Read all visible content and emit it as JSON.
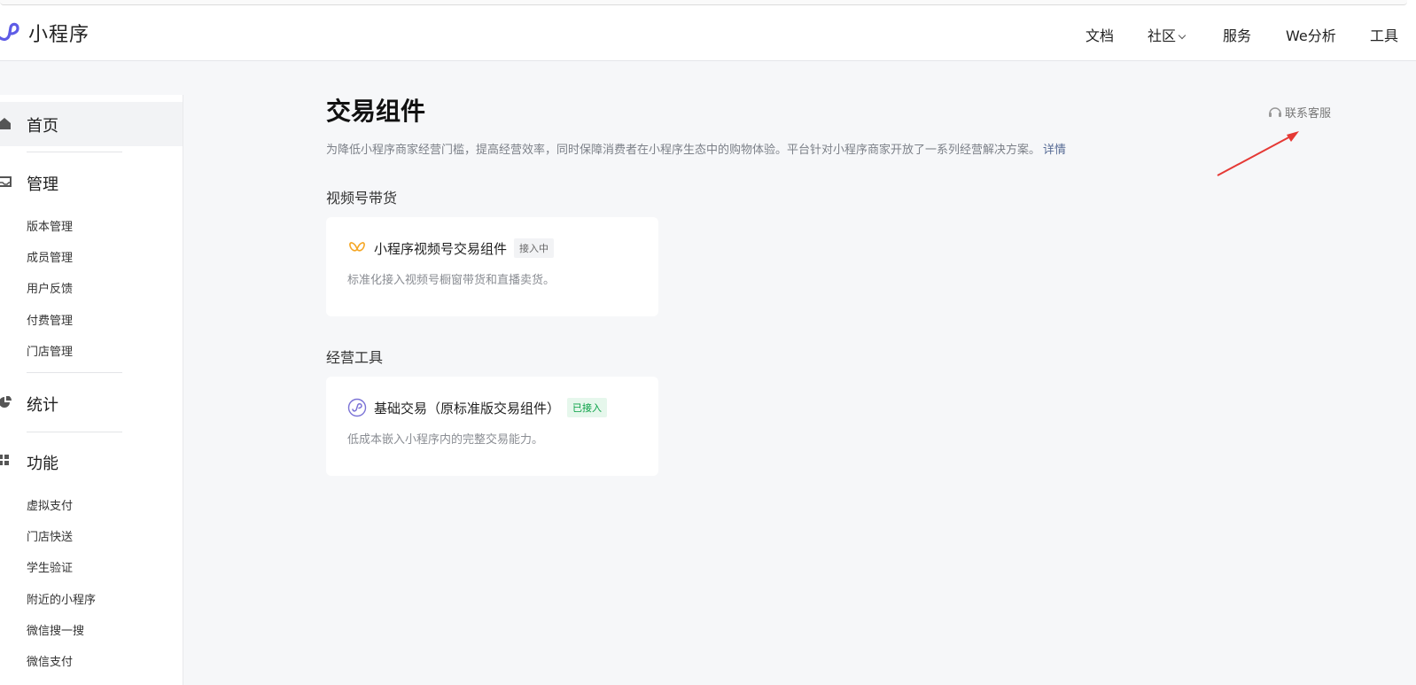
{
  "app": {
    "logo_text": "小程序"
  },
  "nav": {
    "items": [
      {
        "label": "文档"
      },
      {
        "label": "社区"
      },
      {
        "label": "服务"
      },
      {
        "label": "We分析"
      },
      {
        "label": "工具"
      }
    ]
  },
  "sidebar": {
    "home": "首页",
    "manage": "管理",
    "manage_items": [
      "版本管理",
      "成员管理",
      "用户反馈",
      "付费管理",
      "门店管理"
    ],
    "stats": "统计",
    "features": "功能",
    "feature_items": [
      "虚拟支付",
      "门店快送",
      "学生验证",
      "附近的小程序",
      "微信搜一搜",
      "微信支付"
    ]
  },
  "main": {
    "title": "交易组件",
    "description": "为降低小程序商家经营门槛，提高经营效率，同时保障消费者在小程序生态中的购物体验。平台针对小程序商家开放了一系列经营解决方案。",
    "detail_link": "详情",
    "contact": "联系客服",
    "sections": [
      {
        "title": "视频号带货",
        "card": {
          "title": "小程序视频号交易组件",
          "badge": "接入中",
          "desc": "标准化接入视频号橱窗带货和直播卖货。",
          "icon": "butterfly-icon"
        }
      },
      {
        "title": "经营工具",
        "card": {
          "title": "基础交易（原标准版交易组件）",
          "badge": "已接入",
          "desc": "低成本嵌入小程序内的完整交易能力。",
          "icon": "miniprogram-icon"
        }
      }
    ]
  },
  "colors": {
    "accent_link": "#576b95",
    "badge_green": "#07a044",
    "logo_purple": "#5e5ce6",
    "annotation_arrow": "#e53935"
  }
}
